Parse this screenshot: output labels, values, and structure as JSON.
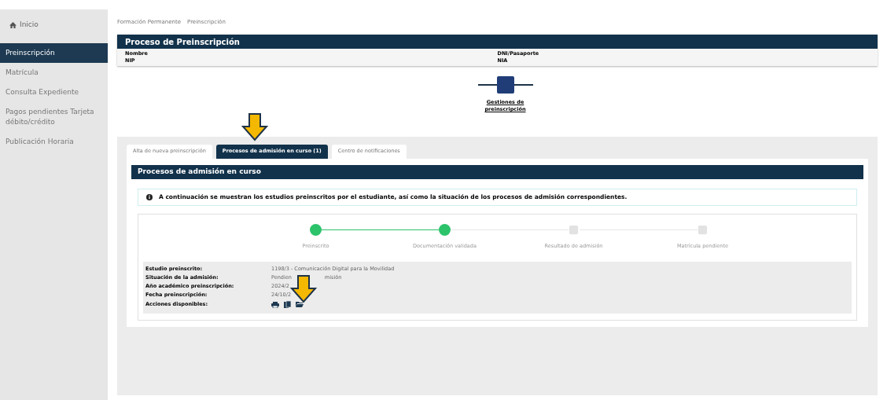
{
  "sidebar": {
    "home": "Inicio",
    "items": [
      {
        "label": "Preinscripción",
        "selected": true
      },
      {
        "label": "Matrícula",
        "selected": false
      },
      {
        "label": "Consulta Expediente",
        "selected": false
      },
      {
        "label": "Pagos pendientes Tarjeta débito/crédito",
        "selected": false
      },
      {
        "label": "Publicación Horaria",
        "selected": false
      }
    ]
  },
  "breadcrumb": [
    "Formación Permanente",
    "Preinscripción"
  ],
  "header": {
    "title": "Proceso de Preinscripción",
    "fields": [
      "Nombre",
      "NIP",
      "DNI/Pasaporte",
      "NIA"
    ]
  },
  "top_step": {
    "label": "Gestiones de preinscripción"
  },
  "tabs": [
    {
      "label": "Alta de nueva preinscripción",
      "selected": false
    },
    {
      "label": "Procesos de admisión en curso (1)",
      "selected": true
    },
    {
      "label": "Centro de notificaciones",
      "selected": false
    }
  ],
  "panel": {
    "title": "Procesos de admisión en curso",
    "info": "A continuación se muestran los estudios preinscritos por el estudiante, así como la situación de los procesos de admisión correspondientes.",
    "steps": [
      {
        "label": "Preinscrito",
        "done": true
      },
      {
        "label": "Documentación validada",
        "done": true
      },
      {
        "label": "Resultado de admisión",
        "done": false
      },
      {
        "label": "Matrícula pendiente",
        "done": false
      }
    ],
    "details": [
      {
        "label": "Estudio preinscrito:",
        "value": "1198/3 - Comunicación Digital para la Movilidad"
      },
      {
        "label": "Situación de la admisión:",
        "value": "Pendien",
        "value_after": "misión"
      },
      {
        "label": "Año académico preinscripción:",
        "value": "2024/2"
      },
      {
        "label": "Fecha preinscripción:",
        "value": "24/10/2"
      }
    ],
    "actions_label": "Acciones disponibles:"
  }
}
